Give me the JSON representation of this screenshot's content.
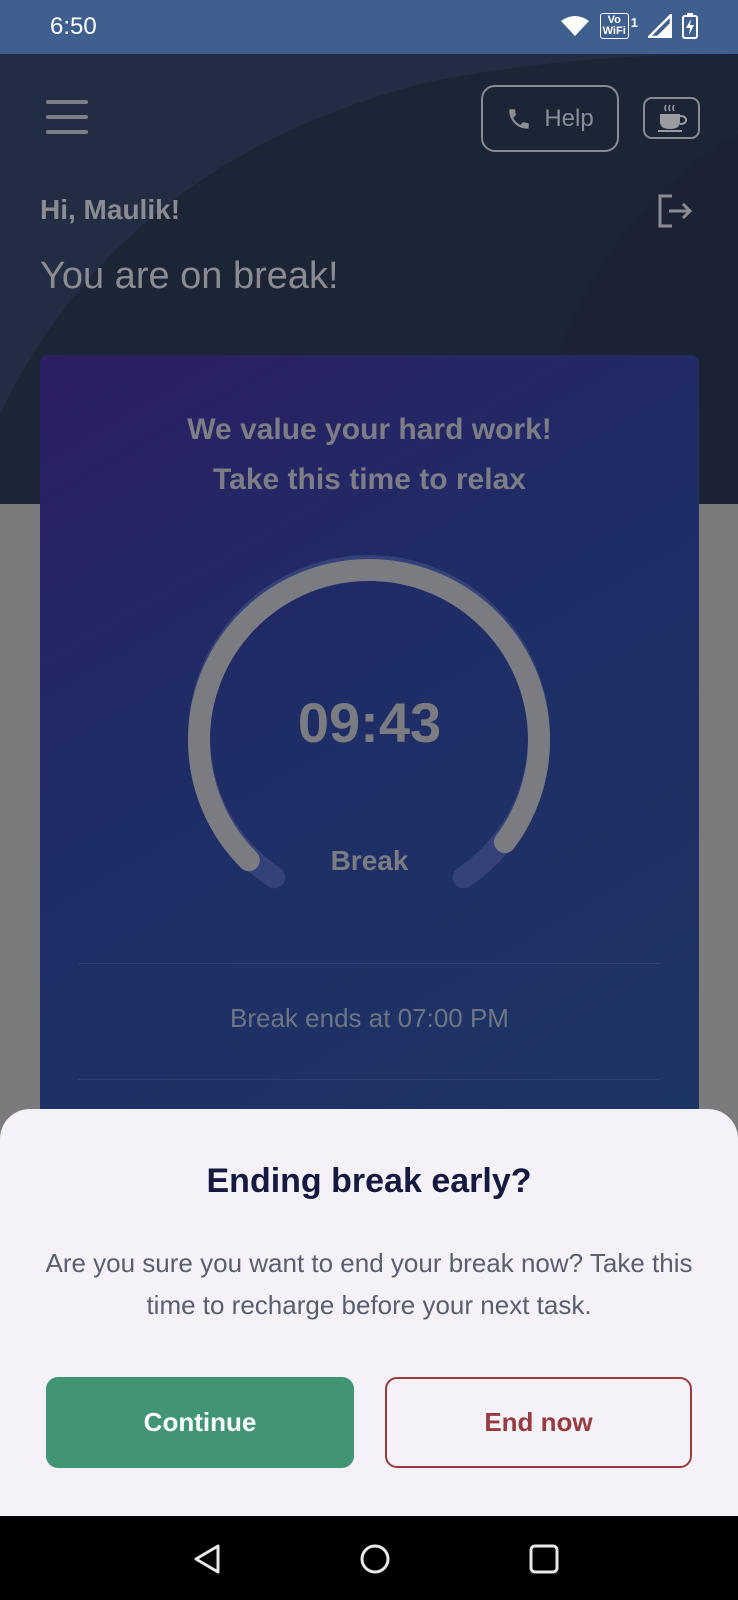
{
  "status_bar": {
    "time": "6:50",
    "network_badge_top": "Vo",
    "network_badge_bottom": "WiFi",
    "sim_slot": "1",
    "icons": [
      "wifi-icon",
      "vowifi-icon",
      "signal-icon",
      "battery-charging-icon"
    ]
  },
  "header": {
    "menu_icon": "hamburger-menu-icon",
    "help_label": "Help",
    "help_icon": "phone-icon",
    "break_icon": "coffee-cup-icon",
    "greeting": "Hi, Maulik!",
    "logout_icon": "logout-icon",
    "status_title": "You are on break!"
  },
  "break_card": {
    "message_line1": "We value your hard work!",
    "message_line2": "Take this time to relax",
    "timer": "09:43",
    "timer_label": "Break",
    "remaining_fraction": 0.97,
    "break_ends_text": "Break ends at 07:00 PM"
  },
  "dialog": {
    "title": "Ending break early?",
    "body": "Are you sure you want to end your break now? Take this time to recharge before your next task.",
    "continue_label": "Continue",
    "end_label": "End now"
  },
  "nav_bar": {
    "buttons": [
      "back-icon",
      "home-icon",
      "recents-icon"
    ]
  },
  "colors": {
    "header_bg": "#1c2536",
    "card_gradient_start": "#2d1e63",
    "card_gradient_end": "#1d3564",
    "continue_button": "#419575",
    "end_button": "#9a3a3f",
    "sheet_bg": "#f4f1f8"
  }
}
